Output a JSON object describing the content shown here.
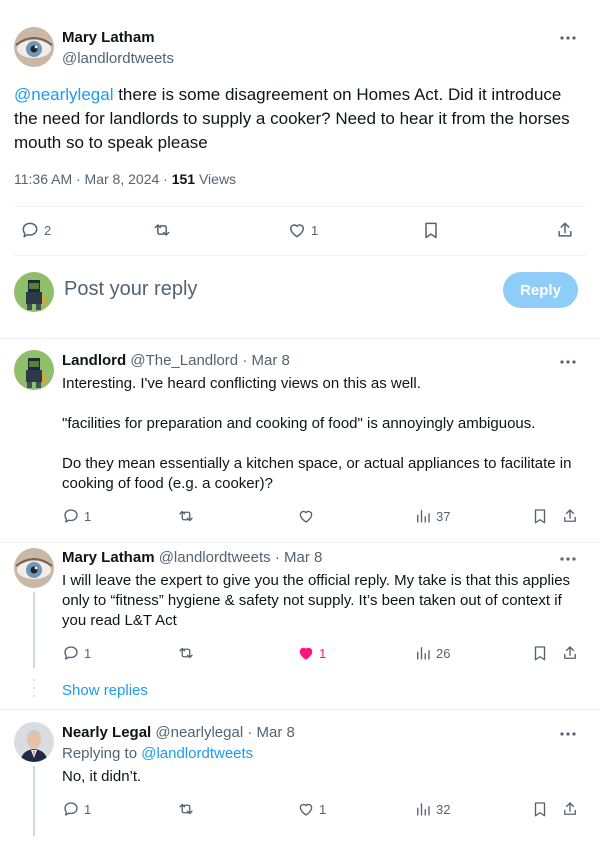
{
  "main_tweet": {
    "author_name": "Mary Latham",
    "author_handle": "@landlordtweets",
    "mention": "@nearlylegal",
    "text_rest": " there is some disagreement on Homes Act. Did it introduce the need for landlords to supply a cooker?  Need to hear it from the horses mouth so to speak please",
    "timestamp": "11:36 AM · Mar 8, 2024 · ",
    "views_count": "151",
    "views_label": " Views",
    "replies": "2",
    "likes": "1"
  },
  "reply_composer": {
    "placeholder": "Post your reply",
    "button_label": "Reply"
  },
  "replies": [
    {
      "author_name": "Landlord",
      "author_handle": "@The_Landlord",
      "date": "· Mar 8",
      "paragraphs": [
        "Interesting. I've heard conflicting views on this as well.",
        "\"facilities for preparation and cooking of food\" is annoyingly ambiguous.",
        "Do they mean essentially a kitchen space, or actual appliances to facilitate in cooking of food (e.g. a cooker)?"
      ],
      "replies": "1",
      "likes": "",
      "views": "37"
    },
    {
      "author_name": "Mary Latham",
      "author_handle": "@landlordtweets",
      "date": "· Mar 8",
      "text": "I will leave the expert to give you the official reply. My take is that this applies only to “fitness” hygiene & safety not supply. It’s been taken out of context if you read L&T Act",
      "replies": "1",
      "likes": "1",
      "views": "26"
    },
    {
      "author_name": "Nearly Legal",
      "author_handle": "@nearlylegal",
      "date": "· Mar 8",
      "replying_prefix": "Replying to ",
      "replying_to": "@landlordtweets",
      "text": "No, it didn’t.",
      "replies": "1",
      "likes": "1",
      "views": "32"
    }
  ],
  "show_replies_label": "Show replies",
  "colors": {
    "accent": "#1d9bf0",
    "like_active": "#f91880",
    "muted": "#536471"
  }
}
